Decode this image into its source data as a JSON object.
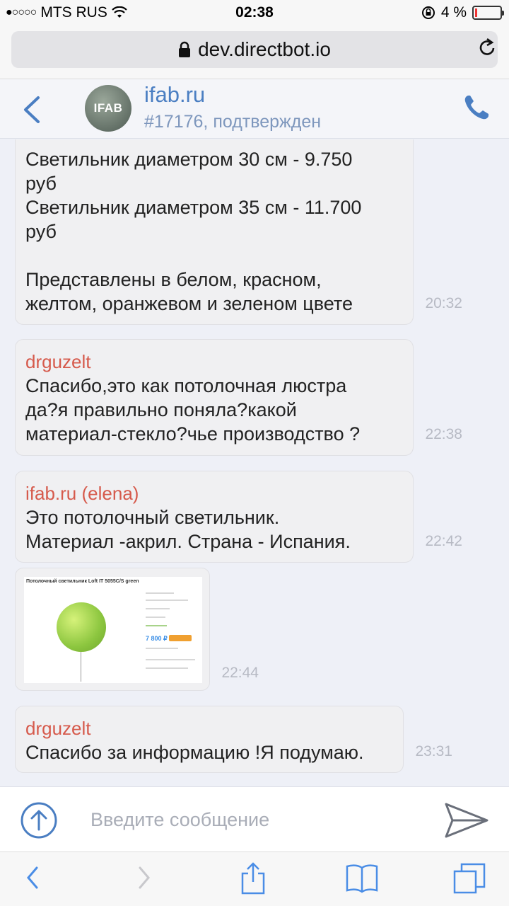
{
  "status_bar": {
    "carrier": "MTS RUS",
    "time": "02:38",
    "battery": "4 %",
    "battery_level": 0.04
  },
  "browser": {
    "url": "dev.directbot.io"
  },
  "chat_header": {
    "avatar_text": "IFAB",
    "title": "ifab.ru",
    "subtitle": "#17176, подтвержден"
  },
  "messages": [
    {
      "text": "Светильник диаметром 30 см - 9.750\nруб\nСветильник диаметром 35 см - 11.700\nруб\n\nПредставлены в белом, красном,\nжелтом, оранжевом и зеленом цвете",
      "time": "20:32"
    },
    {
      "sender": "drguzelt",
      "text": "Спасибо,это как потолочная люстра\nда?я правильно поняла?какой\nматериал-стекло?чье производство ?",
      "time": "22:38"
    },
    {
      "sender": "ifab.ru",
      "sender_sub": "(elena)",
      "text": "Это потолочный светильник.\nМатериал -акрил. Страна - Испания.",
      "time": "22:42"
    },
    {
      "image_caption": "Потолочный светильник Loft IT 5055C/S green",
      "image_price": "7 800 ₽",
      "time": "22:44"
    },
    {
      "sender": "drguzelt",
      "text": "Спасибо за информацию !Я подумаю.",
      "time": "23:31"
    }
  ],
  "composer": {
    "placeholder": "Введите сообщение"
  },
  "icons": {
    "lock": "lock-icon",
    "reload": "reload-icon",
    "back": "chevron-left-icon",
    "phone": "phone-icon",
    "attach": "upload-arrow-icon",
    "send": "paper-plane-icon",
    "toolbar": [
      "back-icon",
      "forward-icon",
      "share-icon",
      "bookmarks-icon",
      "tabs-icon"
    ]
  },
  "colors": {
    "accent": "#4a7ec2",
    "sender": "#d65a4c",
    "time": "#b7bac4"
  }
}
